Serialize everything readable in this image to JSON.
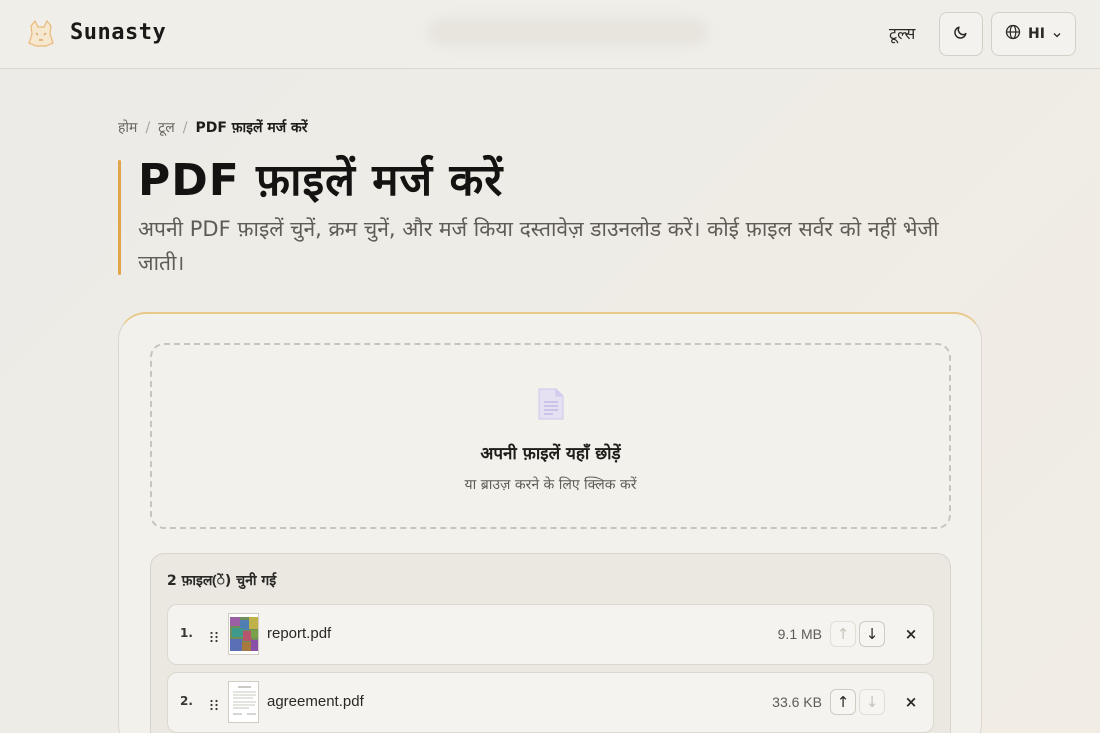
{
  "header": {
    "brand": "Sunasty",
    "tools_link": "टूल्स",
    "language_label": "HI",
    "icons": [
      "fox-logo-icon",
      "moon-icon",
      "globe-icon",
      "chevron-down-icon"
    ]
  },
  "breadcrumb": {
    "home": "होम",
    "separator": "/",
    "tools": "टूल",
    "current": "PDF फ़ाइलें मर्ज करें"
  },
  "page": {
    "title": "PDF फ़ाइलें मर्ज करें",
    "description": "अपनी PDF फ़ाइलें चुनें, क्रम चुनें, और मर्ज किया दस्तावेज़ डाउनलोड करें। कोई फ़ाइल सर्वर को नहीं भेजी जाती।"
  },
  "dropzone": {
    "title": "अपनी फ़ाइलें यहाँ छोड़ें",
    "subtitle": "या ब्राउज़ करने के लिए क्लिक करें",
    "icon": "document-icon"
  },
  "files": {
    "count_label": "2 फ़ाइल(ें) चुनी गई",
    "items": [
      {
        "index": "1.",
        "name": "report.pdf",
        "size": "9.1 MB",
        "up_enabled": false,
        "down_enabled": true,
        "up": "↑",
        "down": "↓",
        "remove": "×"
      },
      {
        "index": "2.",
        "name": "agreement.pdf",
        "size": "33.6 KB",
        "up_enabled": true,
        "down_enabled": false,
        "up": "↑",
        "down": "↓",
        "remove": "×"
      }
    ]
  },
  "colors": {
    "accent": "#e0a44a",
    "background": "#ecebe7",
    "card": "#f3f1ec",
    "doc_icon": "#b9aee0"
  }
}
